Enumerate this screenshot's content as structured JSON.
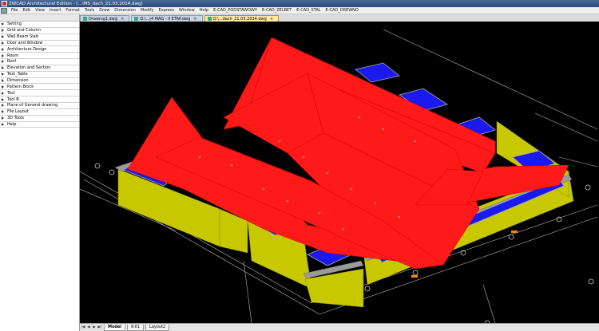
{
  "window": {
    "title": "ZWCAD Architectural Edition - [...\\MS_dach_21.03.2014.dwg]"
  },
  "menu": [
    "File",
    "Edit",
    "View",
    "Insert",
    "Format",
    "Tools",
    "Draw",
    "Dimension",
    "Modify",
    "Express",
    "Window",
    "Help",
    "E-CAD_PODSTAWOWY",
    "E-CAD_ZELBET",
    "E-CAD_STAL",
    "E-CAD_DREWNO"
  ],
  "doc_tabs": [
    {
      "label": "Drawing1.dwg"
    },
    {
      "label": "Q:\\...\\4 MAG - II ETAP.dwg"
    },
    {
      "label": "Q:\\...dach_21.03.2014.dwg"
    }
  ],
  "left_menu": [
    "Setting",
    "Grid and Column",
    "Wall Beam Slab",
    "Door and Window",
    "Architecture Design",
    "Room",
    "Roof",
    "Elevation and Section",
    "Text_Table",
    "Dimension",
    "Pattern Block",
    "Tool",
    "Tool B",
    "Plane of General drawing",
    "File Layout",
    "3D Tools",
    "Help"
  ],
  "layout_tabs": [
    "Model",
    "K-01",
    "Layout2"
  ],
  "colors": {
    "roof": "#ff1a1a",
    "skylight": "#1a1aee",
    "wall": "#c8c800",
    "background": "#000000",
    "grid_line": "#c0c0c0"
  }
}
